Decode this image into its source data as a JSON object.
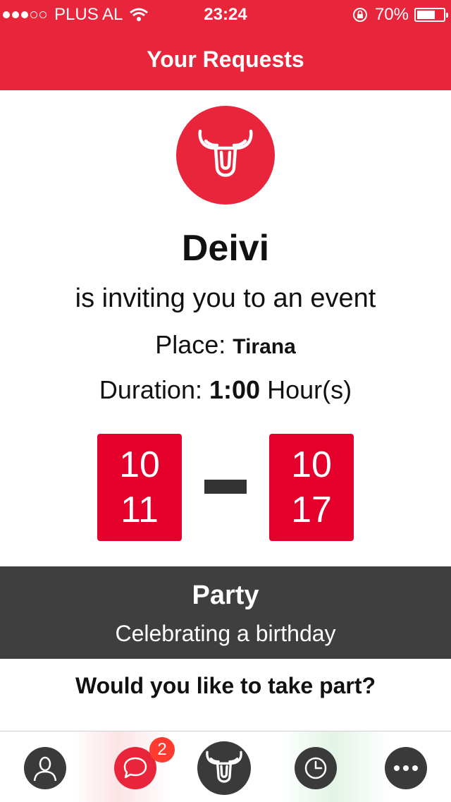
{
  "status_bar": {
    "carrier": "PLUS AL",
    "time": "23:24",
    "battery": "70%",
    "battery_level": 0.7
  },
  "nav": {
    "title": "Your Requests"
  },
  "request": {
    "name": "Deivi",
    "invite_text": "is inviting you to an event",
    "place_label": "Place:",
    "place_value": "Tirana",
    "duration_label": "Duration:",
    "duration_value": "1:00",
    "duration_unit": "Hour(s)"
  },
  "dates": {
    "start": {
      "top": "10",
      "bottom": "11"
    },
    "end": {
      "top": "10",
      "bottom": "17"
    }
  },
  "event": {
    "title": "Party",
    "subtitle": "Celebrating a birthday"
  },
  "question": "Would you like to take part?",
  "tabbar": {
    "chat_badge": "2",
    "items": [
      "profile-icon",
      "chat-icon",
      "bull-logo-icon",
      "clock-icon",
      "more-icon"
    ]
  },
  "colors": {
    "brand_red": "#e8253a",
    "date_red": "#e4002b",
    "dark_gray": "#3f3f3f",
    "badge_red": "#ff3b30"
  }
}
